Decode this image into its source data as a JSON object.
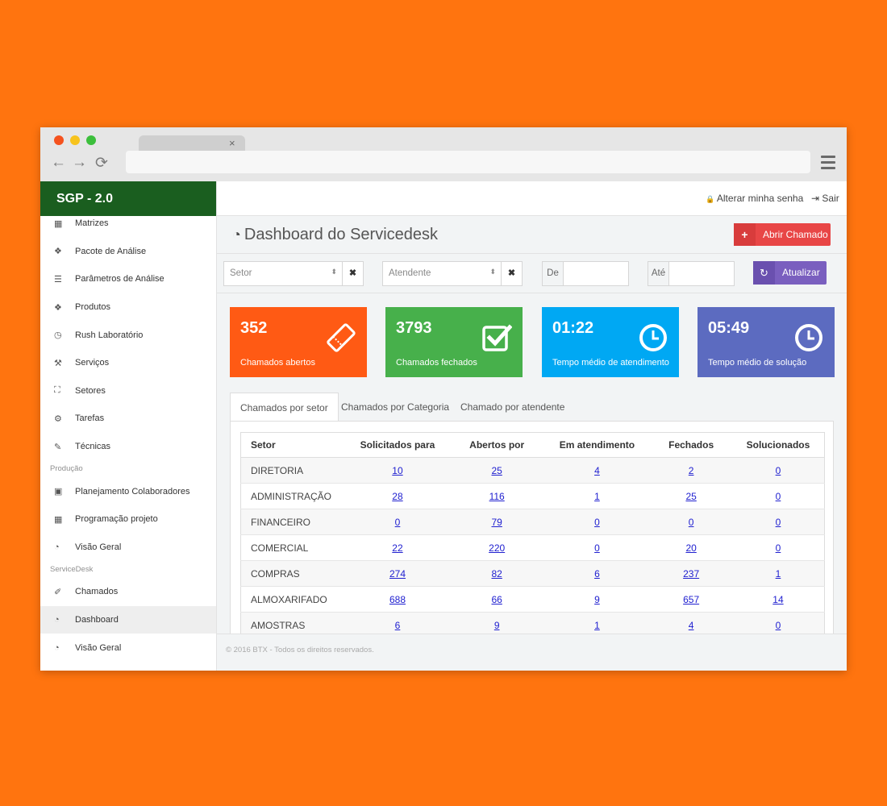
{
  "browser": {
    "tab_close": "×",
    "back_icon": "←",
    "forward_icon": "→",
    "reload_icon": "⟳"
  },
  "sidebar": {
    "brand": "SGP - 2.0",
    "items": [
      {
        "label": "Matrizes",
        "icon": "▦",
        "icon_name": "table-icon"
      },
      {
        "label": "Pacote de Análise",
        "icon": "❖",
        "icon_name": "dropbox-icon"
      },
      {
        "label": "Parâmetros de Análise",
        "icon": "☰",
        "icon_name": "list-icon"
      },
      {
        "label": "Produtos",
        "icon": "❖",
        "icon_name": "dropbox-icon"
      },
      {
        "label": "Rush Laboratório",
        "icon": "◷",
        "icon_name": "clock-icon"
      },
      {
        "label": "Serviços",
        "icon": "⚒",
        "icon_name": "gavel-icon"
      },
      {
        "label": "Setores",
        "icon": "⛶",
        "icon_name": "sitemap-icon"
      },
      {
        "label": "Tarefas",
        "icon": "⚙",
        "icon_name": "cogs-icon"
      },
      {
        "label": "Técnicas",
        "icon": "✎",
        "icon_name": "eyedropper-icon"
      }
    ],
    "section_producao": "Produção",
    "producao_items": [
      {
        "label": "Planejamento Colaboradores",
        "icon": "▣",
        "icon_name": "calendar-check-icon"
      },
      {
        "label": "Programação projeto",
        "icon": "▦",
        "icon_name": "calendar-icon"
      },
      {
        "label": "Visão Geral",
        "icon": "◔",
        "icon_name": "dashboard-icon"
      }
    ],
    "section_servicedesk": "ServiceDesk",
    "servicedesk_items": [
      {
        "label": "Chamados",
        "icon": "✐",
        "icon_name": "ticket-icon"
      },
      {
        "label": "Dashboard",
        "icon": "◔",
        "icon_name": "dashboard-icon"
      },
      {
        "label": "Visão Geral",
        "icon": "◔",
        "icon_name": "dashboard-icon"
      }
    ]
  },
  "topbar": {
    "change_password": "Alterar minha senha",
    "change_password_icon": "🔒",
    "logout": "Sair",
    "logout_icon": "⇥"
  },
  "page": {
    "title": "Dashboard do Servicedesk",
    "title_icon": "◔",
    "open_ticket": "Abrir Chamado",
    "open_ticket_icon": "+"
  },
  "filters": {
    "setor_placeholder": "Setor",
    "atendente_placeholder": "Atendente",
    "clear_icon": "✖",
    "dropdown_icon": "⬍",
    "de_label": "De",
    "ate_label": "Até",
    "update_button": "Atualizar",
    "update_icon": "↻"
  },
  "stats": [
    {
      "value": "352",
      "label": "Chamados abertos",
      "color": "#ff5a14",
      "icon": "ticket-icon"
    },
    {
      "value": "3793",
      "label": "Chamados fechados",
      "color": "#47b04b",
      "icon": "check-square-icon"
    },
    {
      "value": "01:22",
      "label": "Tempo médio de atendimento",
      "color": "#00a8f3",
      "icon": "clock-icon"
    },
    {
      "value": "05:49",
      "label": "Tempo médio de solução",
      "color": "#5c6bc0",
      "icon": "clock-icon"
    }
  ],
  "tabs": [
    "Chamados por setor",
    "Chamados por Categoria",
    "Chamado por atendente"
  ],
  "table": {
    "headers": [
      "Setor",
      "Solicitados para",
      "Abertos por",
      "Em atendimento",
      "Fechados",
      "Solucionados"
    ],
    "rows": [
      [
        "DIRETORIA",
        "10",
        "25",
        "4",
        "2",
        "0"
      ],
      [
        "ADMINISTRAÇÃO",
        "28",
        "116",
        "1",
        "25",
        "0"
      ],
      [
        "FINANCEIRO",
        "0",
        "79",
        "0",
        "0",
        "0"
      ],
      [
        "COMERCIAL",
        "22",
        "220",
        "0",
        "20",
        "0"
      ],
      [
        "COMPRAS",
        "274",
        "82",
        "6",
        "237",
        "1"
      ],
      [
        "ALMOXARIFADO",
        "688",
        "66",
        "9",
        "657",
        "14"
      ],
      [
        "AMOSTRAS",
        "6",
        "9",
        "1",
        "4",
        "0"
      ]
    ]
  },
  "footer": "© 2016 BTX - Todos os direitos reservados."
}
